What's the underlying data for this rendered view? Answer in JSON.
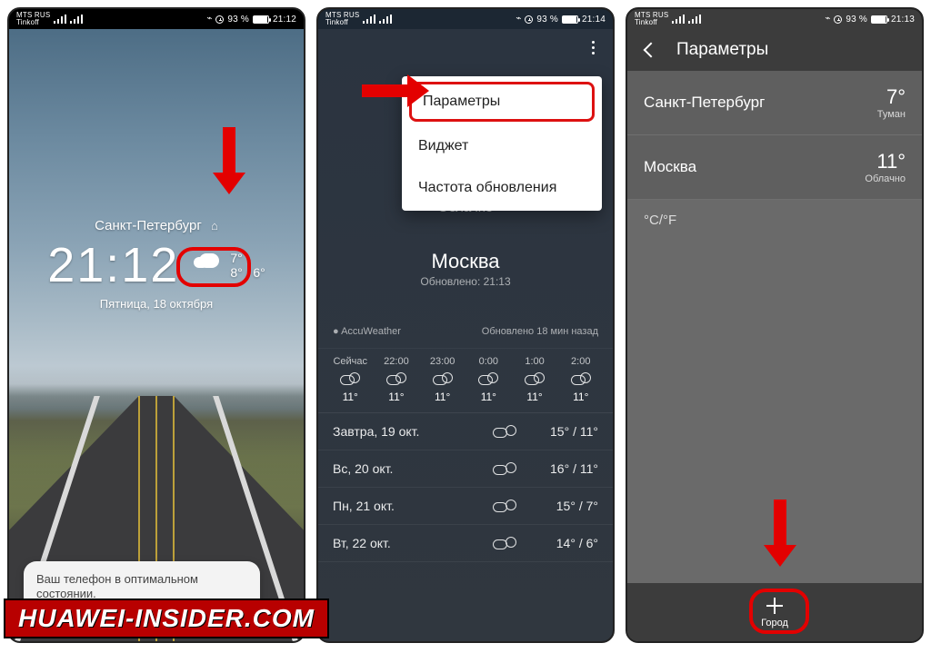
{
  "status": {
    "carrier1": "MTS RUS",
    "carrier2": "Tinkoff",
    "battery": "93 %",
    "time1": "21:12",
    "time2": "21:14",
    "time3": "21:13"
  },
  "phone1": {
    "city": "Санкт-Петербург",
    "clock": "21:12",
    "temp_now": "7°",
    "temp_hi_lo": "8° / 6°",
    "date": "Пятница, 18 октября",
    "toast": "Ваш телефон в оптимальном состоянии."
  },
  "phone2": {
    "menu": {
      "settings": "Параметры",
      "widget": "Виджет",
      "freq": "Частота обновления"
    },
    "cond_top": "Облачно",
    "city": "Москва",
    "updated": "Обновлено: 21:13",
    "attrib_left": "AccuWeather",
    "attrib_right": "Обновлено 18 мин назад",
    "hourly": [
      {
        "label": "Сейчас",
        "temp": "11°"
      },
      {
        "label": "22:00",
        "temp": "11°"
      },
      {
        "label": "23:00",
        "temp": "11°"
      },
      {
        "label": "0:00",
        "temp": "11°"
      },
      {
        "label": "1:00",
        "temp": "11°"
      },
      {
        "label": "2:00",
        "temp": "11°"
      }
    ],
    "daily": [
      {
        "day": "Завтра, 19 окт.",
        "temp": "15° / 11°"
      },
      {
        "day": "Вс, 20 окт.",
        "temp": "16° / 11°"
      },
      {
        "day": "Пн, 21 окт.",
        "temp": "15° / 7°"
      },
      {
        "day": "Вт, 22 окт.",
        "temp": "14° / 6°"
      }
    ]
  },
  "phone3": {
    "title": "Параметры",
    "cities": [
      {
        "name": "Санкт-Петербург",
        "temp": "7°",
        "cond": "Туман"
      },
      {
        "name": "Москва",
        "temp": "11°",
        "cond": "Облачно"
      }
    ],
    "units": "°C/°F",
    "add": "Город"
  },
  "watermark": "HUAWEI-INSIDER.COM"
}
